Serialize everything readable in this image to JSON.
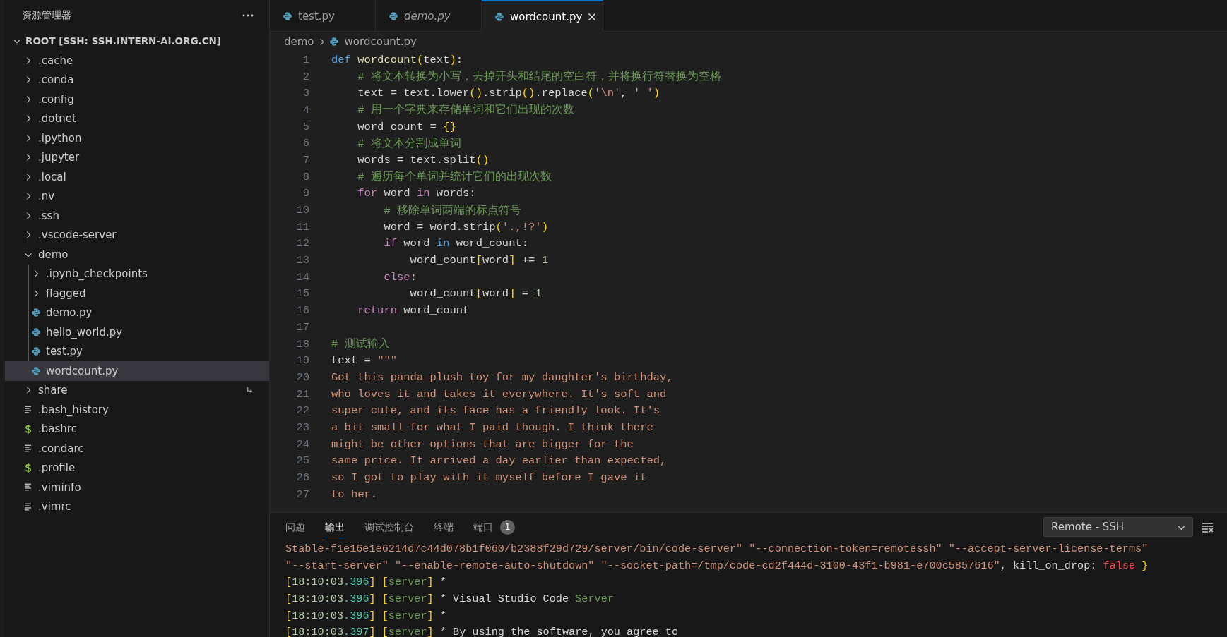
{
  "sidebar": {
    "title": "资源管理器",
    "root": {
      "label": "ROOT [SSH: SSH.INTERN-AI.ORG.CN]",
      "expanded": true
    },
    "items": [
      {
        "label": ".cache",
        "kind": "folder",
        "expanded": false,
        "selected": false,
        "symlink": false
      },
      {
        "label": ".conda",
        "kind": "folder",
        "expanded": false,
        "selected": false,
        "symlink": false
      },
      {
        "label": ".config",
        "kind": "folder",
        "expanded": false,
        "selected": false,
        "symlink": false
      },
      {
        "label": ".dotnet",
        "kind": "folder",
        "expanded": false,
        "selected": false,
        "symlink": false
      },
      {
        "label": ".ipython",
        "kind": "folder",
        "expanded": false,
        "selected": false,
        "symlink": false
      },
      {
        "label": ".jupyter",
        "kind": "folder",
        "expanded": false,
        "selected": false,
        "symlink": false
      },
      {
        "label": ".local",
        "kind": "folder",
        "expanded": false,
        "selected": false,
        "symlink": false
      },
      {
        "label": ".nv",
        "kind": "folder",
        "expanded": false,
        "selected": false,
        "symlink": false
      },
      {
        "label": ".ssh",
        "kind": "folder",
        "expanded": false,
        "selected": false,
        "symlink": false
      },
      {
        "label": ".vscode-server",
        "kind": "folder",
        "expanded": false,
        "selected": false,
        "symlink": false
      },
      {
        "label": "demo",
        "kind": "folder",
        "expanded": true,
        "selected": false,
        "symlink": false,
        "children": [
          {
            "label": ".ipynb_checkpoints",
            "kind": "folder",
            "expanded": false,
            "selected": false,
            "symlink": false
          },
          {
            "label": "flagged",
            "kind": "folder",
            "expanded": false,
            "selected": false,
            "symlink": false
          },
          {
            "label": "demo.py",
            "kind": "python",
            "selected": false,
            "symlink": false
          },
          {
            "label": "hello_world.py",
            "kind": "python",
            "selected": false,
            "symlink": false
          },
          {
            "label": "test.py",
            "kind": "python",
            "selected": false,
            "symlink": false
          },
          {
            "label": "wordcount.py",
            "kind": "python",
            "selected": true,
            "symlink": false
          }
        ]
      },
      {
        "label": "share",
        "kind": "folder",
        "expanded": false,
        "selected": false,
        "symlink": true
      },
      {
        "label": ".bash_history",
        "kind": "text",
        "selected": false,
        "symlink": false
      },
      {
        "label": ".bashrc",
        "kind": "shell",
        "selected": false,
        "symlink": false
      },
      {
        "label": ".condarc",
        "kind": "text",
        "selected": false,
        "symlink": false
      },
      {
        "label": ".profile",
        "kind": "shell",
        "selected": false,
        "symlink": false
      },
      {
        "label": ".viminfo",
        "kind": "text",
        "selected": false,
        "symlink": false
      },
      {
        "label": ".vimrc",
        "kind": "text",
        "selected": false,
        "symlink": false
      }
    ]
  },
  "tabs": [
    {
      "label": "test.py",
      "selected": false,
      "preview": false
    },
    {
      "label": "demo.py",
      "selected": false,
      "preview": true
    },
    {
      "label": "wordcount.py",
      "selected": true,
      "preview": false
    }
  ],
  "breadcrumb": [
    "demo",
    "wordcount.py"
  ],
  "code": [
    {
      "number": "1",
      "tokens": [
        {
          "kind": "kw",
          "text": "def "
        },
        {
          "kind": "fn",
          "text": "wordcount"
        },
        {
          "kind": "br",
          "text": "("
        },
        {
          "kind": "plain",
          "text": "text"
        },
        {
          "kind": "br",
          "text": ")"
        },
        {
          "kind": "plain",
          "text": ":"
        }
      ]
    },
    {
      "number": "2",
      "tokens": [
        {
          "kind": "comment",
          "text": "    # 将文本转换为小写，去掉开头和结尾的空白符，并将换行符替换为空格"
        }
      ]
    },
    {
      "number": "3",
      "tokens": [
        {
          "kind": "plain",
          "text": "    text = text.lower"
        },
        {
          "kind": "br",
          "text": "()"
        },
        {
          "kind": "plain",
          "text": ".strip"
        },
        {
          "kind": "br",
          "text": "()"
        },
        {
          "kind": "plain",
          "text": ".replace"
        },
        {
          "kind": "br",
          "text": "("
        },
        {
          "kind": "str",
          "text": "'\\n'"
        },
        {
          "kind": "plain",
          "text": ", "
        },
        {
          "kind": "str",
          "text": "' '"
        },
        {
          "kind": "br",
          "text": ")"
        }
      ]
    },
    {
      "number": "4",
      "tokens": [
        {
          "kind": "comment",
          "text": "    # 用一个字典来存储单词和它们出现的次数"
        }
      ]
    },
    {
      "number": "5",
      "tokens": [
        {
          "kind": "plain",
          "text": "    word_count = "
        },
        {
          "kind": "br",
          "text": "{}"
        }
      ]
    },
    {
      "number": "6",
      "tokens": [
        {
          "kind": "comment",
          "text": "    # 将文本分割成单词"
        }
      ]
    },
    {
      "number": "7",
      "tokens": [
        {
          "kind": "plain",
          "text": "    words = text.split"
        },
        {
          "kind": "br",
          "text": "()"
        }
      ]
    },
    {
      "number": "8",
      "tokens": [
        {
          "kind": "comment",
          "text": "    # 遍历每个单词并统计它们的出现次数"
        }
      ]
    },
    {
      "number": "9",
      "tokens": [
        {
          "kind": "ctrl",
          "text": "    for"
        },
        {
          "kind": "plain",
          "text": " word "
        },
        {
          "kind": "ctrl",
          "text": "in"
        },
        {
          "kind": "plain",
          "text": " words:"
        }
      ]
    },
    {
      "number": "10",
      "tokens": [
        {
          "kind": "comment",
          "text": "        # 移除单词两端的标点符号"
        }
      ]
    },
    {
      "number": "11",
      "tokens": [
        {
          "kind": "plain",
          "text": "        word = word.strip"
        },
        {
          "kind": "br",
          "text": "("
        },
        {
          "kind": "str",
          "text": "'.,!?'"
        },
        {
          "kind": "br",
          "text": ")"
        }
      ]
    },
    {
      "number": "12",
      "tokens": [
        {
          "kind": "ctrl",
          "text": "        if"
        },
        {
          "kind": "plain",
          "text": " word "
        },
        {
          "kind": "kw",
          "text": "in"
        },
        {
          "kind": "plain",
          "text": " word_count:"
        }
      ]
    },
    {
      "number": "13",
      "tokens": [
        {
          "kind": "plain",
          "text": "            word_count"
        },
        {
          "kind": "br",
          "text": "["
        },
        {
          "kind": "plain",
          "text": "word"
        },
        {
          "kind": "br",
          "text": "]"
        },
        {
          "kind": "plain",
          "text": " += "
        },
        {
          "kind": "num",
          "text": "1"
        }
      ]
    },
    {
      "number": "14",
      "tokens": [
        {
          "kind": "ctrl",
          "text": "        else"
        },
        {
          "kind": "plain",
          "text": ":"
        }
      ]
    },
    {
      "number": "15",
      "tokens": [
        {
          "kind": "plain",
          "text": "            word_count"
        },
        {
          "kind": "br",
          "text": "["
        },
        {
          "kind": "plain",
          "text": "word"
        },
        {
          "kind": "br",
          "text": "]"
        },
        {
          "kind": "plain",
          "text": " = "
        },
        {
          "kind": "num",
          "text": "1"
        }
      ]
    },
    {
      "number": "16",
      "tokens": [
        {
          "kind": "ctrl",
          "text": "    return"
        },
        {
          "kind": "plain",
          "text": " word_count"
        }
      ]
    },
    {
      "number": "17"
    },
    {
      "number": "18",
      "tokens": [
        {
          "kind": "comment",
          "text": "# 测试输入"
        }
      ]
    },
    {
      "number": "19",
      "tokens": [
        {
          "kind": "plain",
          "text": "text = "
        },
        {
          "kind": "str",
          "text": "\"\"\""
        }
      ]
    },
    {
      "number": "20",
      "tokens": [
        {
          "kind": "str",
          "text": "Got this panda plush toy for my daughter's birthday,"
        }
      ]
    },
    {
      "number": "21",
      "tokens": [
        {
          "kind": "str",
          "text": "who loves it and takes it everywhere. It's soft and"
        }
      ]
    },
    {
      "number": "22",
      "tokens": [
        {
          "kind": "str",
          "text": "super cute, and its face has a friendly look. It's"
        }
      ]
    },
    {
      "number": "23",
      "tokens": [
        {
          "kind": "str",
          "text": "a bit small for what I paid though. I think there"
        }
      ]
    },
    {
      "number": "24",
      "tokens": [
        {
          "kind": "str",
          "text": "might be other options that are bigger for the"
        }
      ]
    },
    {
      "number": "25",
      "tokens": [
        {
          "kind": "str",
          "text": "same price. It arrived a day earlier than expected,"
        }
      ]
    },
    {
      "number": "26",
      "tokens": [
        {
          "kind": "str",
          "text": "so I got to play with it myself before I gave it"
        }
      ]
    },
    {
      "number": "27",
      "tokens": [
        {
          "kind": "str",
          "text": "to her."
        }
      ]
    }
  ],
  "panel": {
    "tabs": [
      {
        "label": "问题",
        "selected": false
      },
      {
        "label": "输出",
        "selected": true
      },
      {
        "label": "调试控制台",
        "selected": false
      },
      {
        "label": "终端",
        "selected": false
      },
      {
        "label": "端口",
        "selected": false,
        "badge": "1"
      }
    ],
    "channel": "Remote - SSH",
    "output": [
      {
        "tokens": [
          {
            "kind": "str",
            "text": "Stable-f1e16e1e6214d7c44d078b1f060/b2388f29d729/server/bin/code-server\" \"--connection-token=remotessh\" \"--accept-server-license-terms\""
          }
        ]
      },
      {
        "tokens": [
          {
            "kind": "str",
            "text": "\"--start-server\" \"--enable-remote-auto-shutdown\" \"--socket-path=/tmp/code-cd2f444d-3100-43f1-b981-e700c5857616\""
          },
          {
            "kind": "plain",
            "text": ", kill_on_drop: "
          },
          {
            "kind": "false",
            "text": "false"
          },
          {
            "kind": "br",
            "text": " }"
          }
        ]
      },
      {
        "tokens": [
          {
            "kind": "br",
            "text": "["
          },
          {
            "kind": "time",
            "text": "18:10:03"
          },
          {
            "kind": "ms",
            "text": ".396"
          },
          {
            "kind": "br",
            "text": "] ["
          },
          {
            "kind": "tag",
            "text": "server"
          },
          {
            "kind": "br",
            "text": "]"
          },
          {
            "kind": "plain",
            "text": " *"
          }
        ]
      },
      {
        "tokens": [
          {
            "kind": "br",
            "text": "["
          },
          {
            "kind": "time",
            "text": "18:10:03"
          },
          {
            "kind": "ms",
            "text": ".396"
          },
          {
            "kind": "br",
            "text": "] ["
          },
          {
            "kind": "tag",
            "text": "server"
          },
          {
            "kind": "br",
            "text": "]"
          },
          {
            "kind": "plain",
            "text": " * Visual Studio Code "
          },
          {
            "kind": "tag",
            "text": "Server"
          }
        ]
      },
      {
        "tokens": [
          {
            "kind": "br",
            "text": "["
          },
          {
            "kind": "time",
            "text": "18:10:03"
          },
          {
            "kind": "ms",
            "text": ".396"
          },
          {
            "kind": "br",
            "text": "] ["
          },
          {
            "kind": "tag",
            "text": "server"
          },
          {
            "kind": "br",
            "text": "]"
          },
          {
            "kind": "plain",
            "text": " *"
          }
        ]
      },
      {
        "tokens": [
          {
            "kind": "br",
            "text": "["
          },
          {
            "kind": "time",
            "text": "18:10:03"
          },
          {
            "kind": "ms",
            "text": ".397"
          },
          {
            "kind": "br",
            "text": "] ["
          },
          {
            "kind": "tag",
            "text": "server"
          },
          {
            "kind": "br",
            "text": "]"
          },
          {
            "kind": "plain",
            "text": " * By using the software, you agree to"
          }
        ]
      }
    ]
  }
}
